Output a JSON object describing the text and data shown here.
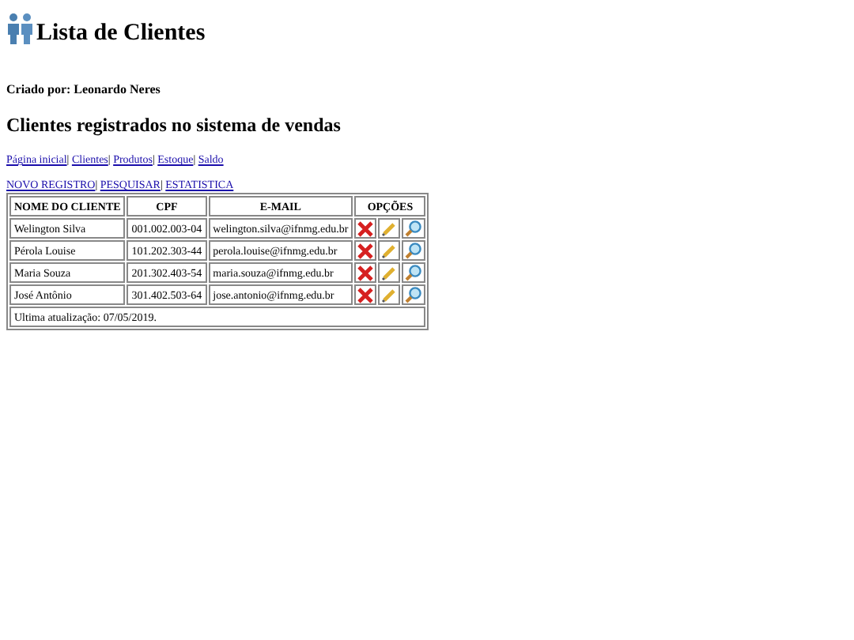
{
  "header": {
    "title": "Lista de Clientes"
  },
  "author": "Criado por: Leonardo Neres",
  "subtitle": "Clientes registrados no sistema de vendas",
  "separator": "|",
  "nav": [
    "Página inicial",
    "Clientes",
    "Produtos",
    "Estoque",
    "Saldo"
  ],
  "actions": [
    "NOVO REGISTRO",
    "PESQUISAR",
    "ESTATISTICA"
  ],
  "table": {
    "columns": [
      "NOME DO CLIENTE",
      "CPF",
      "E-MAIL",
      "OPÇÕES"
    ],
    "rows": [
      {
        "name": "Welington Silva",
        "cpf": "001.002.003-04",
        "email": "welington.silva@ifnmg.edu.br"
      },
      {
        "name": "Pérola Louise",
        "cpf": "101.202.303-44",
        "email": "perola.louise@ifnmg.edu.br"
      },
      {
        "name": "Maria Souza",
        "cpf": "201.302.403-54",
        "email": "maria.souza@ifnmg.edu.br"
      },
      {
        "name": "José Antônio",
        "cpf": "301.402.503-64",
        "email": "jose.antonio@ifnmg.edu.br"
      }
    ],
    "footer": "Ultima atualização: 07/05/2019."
  }
}
